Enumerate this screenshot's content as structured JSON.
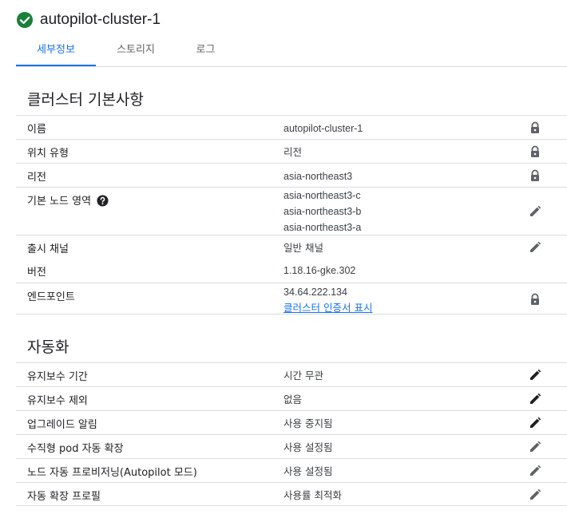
{
  "header": {
    "title": "autopilot-cluster-1",
    "status_color": "#188038"
  },
  "tabs": [
    {
      "label": "세부정보",
      "active": true
    },
    {
      "label": "스토리지",
      "active": false
    },
    {
      "label": "로그",
      "active": false
    }
  ],
  "basics": {
    "title": "클러스터 기본사항",
    "name_label": "이름",
    "name_value": "autopilot-cluster-1",
    "location_type_label": "위치 유형",
    "location_type_value": "리전",
    "region_label": "리전",
    "region_value": "asia-northeast3",
    "zones_label": "기본 노드 영역",
    "zones": [
      "asia-northeast3-c",
      "asia-northeast3-b",
      "asia-northeast3-a"
    ],
    "channel_label": "출시 채널",
    "channel_value": "일반 채널",
    "version_label": "버전",
    "version_value": "1.18.16-gke.302",
    "endpoint_label": "엔드포인트",
    "endpoint_value": "34.64.222.134",
    "cert_link": "클러스터 인증서 표시"
  },
  "automation": {
    "title": "자동화",
    "maint_window_label": "유지보수 기간",
    "maint_window_value": "시간 무관",
    "maint_excl_label": "유지보수 제외",
    "maint_excl_value": "없음",
    "upgrade_notif_label": "업그레이드 알림",
    "upgrade_notif_value": "사용 중지됨",
    "vpa_label": "수직형 pod 자동 확장",
    "vpa_value": "사용 설정됨",
    "nap_label": "노드 자동 프로비저닝(Autopilot 모드)",
    "nap_value": "사용 설정됨",
    "profile_label": "자동 확장 프로필",
    "profile_value": "사용률 최적화"
  }
}
